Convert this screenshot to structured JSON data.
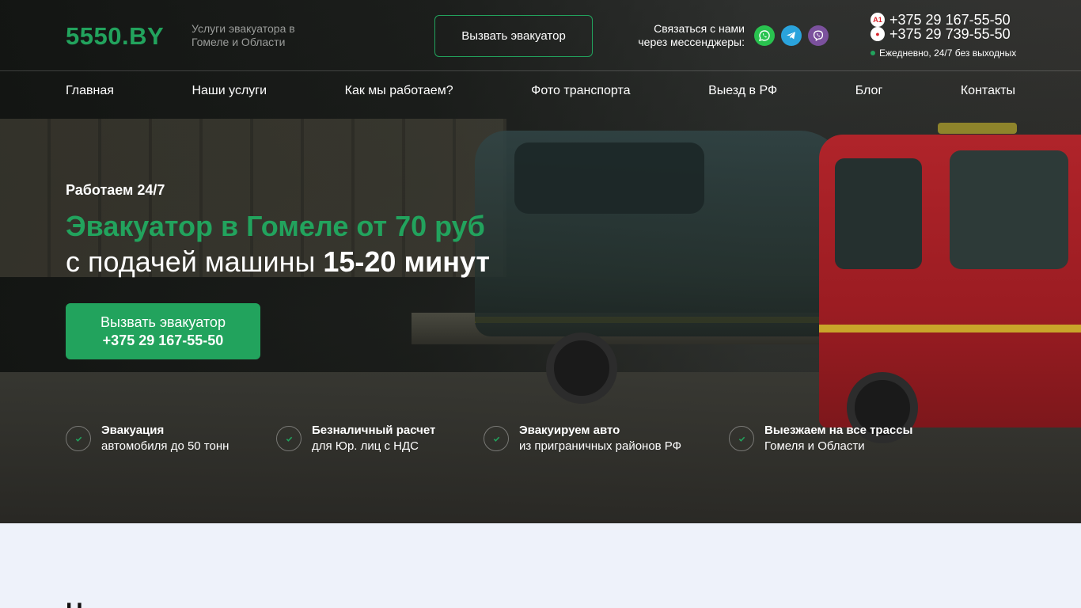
{
  "header": {
    "logo": "5550.BY",
    "tagline": "Услуги эвакуатора в Гомеле и Области",
    "call_button": "Вызвать эвакуатор",
    "messengers_label": "Связаться с нами через мессенджеры:",
    "messengers": [
      {
        "name": "WhatsApp",
        "icon": "whatsapp-icon",
        "color": "#29c24f"
      },
      {
        "name": "Telegram",
        "icon": "telegram-icon",
        "color": "#2aa3dc"
      },
      {
        "name": "Viber",
        "icon": "viber-icon",
        "color": "#7b519d"
      }
    ],
    "phones": [
      {
        "operator": "A1",
        "icon": "a1-operator-icon",
        "number": "+375 29 167-55-50"
      },
      {
        "operator": "MTS",
        "icon": "mts-operator-icon",
        "number": "+375 29 739-55-50"
      }
    ],
    "hours": "Ежедневно, 24/7 без выходных"
  },
  "nav": [
    "Главная",
    "Наши услуги",
    "Как мы работаем?",
    "Фото транспорта",
    "Выезд в РФ",
    "Блог",
    "Контакты"
  ],
  "hero": {
    "eyebrow": "Работаем 24/7",
    "title": "Эвакуатор в Гомеле от 70 руб",
    "subtitle_prefix": "с подачей машины ",
    "subtitle_bold": "15-20 минут",
    "cta_line1": "Вызвать эвакуатор",
    "cta_line2": "+375 29 167-55-50"
  },
  "features": [
    {
      "title": "Эвакуация",
      "desc": "автомобиля до 50 тонн"
    },
    {
      "title": "Безналичный расчет",
      "desc": "для Юр. лиц с НДС"
    },
    {
      "title": "Эвакуируем авто",
      "desc": "из приграничных районов РФ"
    },
    {
      "title": "Выезжаем на все трассы",
      "desc": "Гомеля и Области"
    }
  ],
  "next_section": {
    "title_fragment": "Н"
  },
  "colors": {
    "accent": "#22a35d",
    "page_bg": "#eef2fa"
  }
}
